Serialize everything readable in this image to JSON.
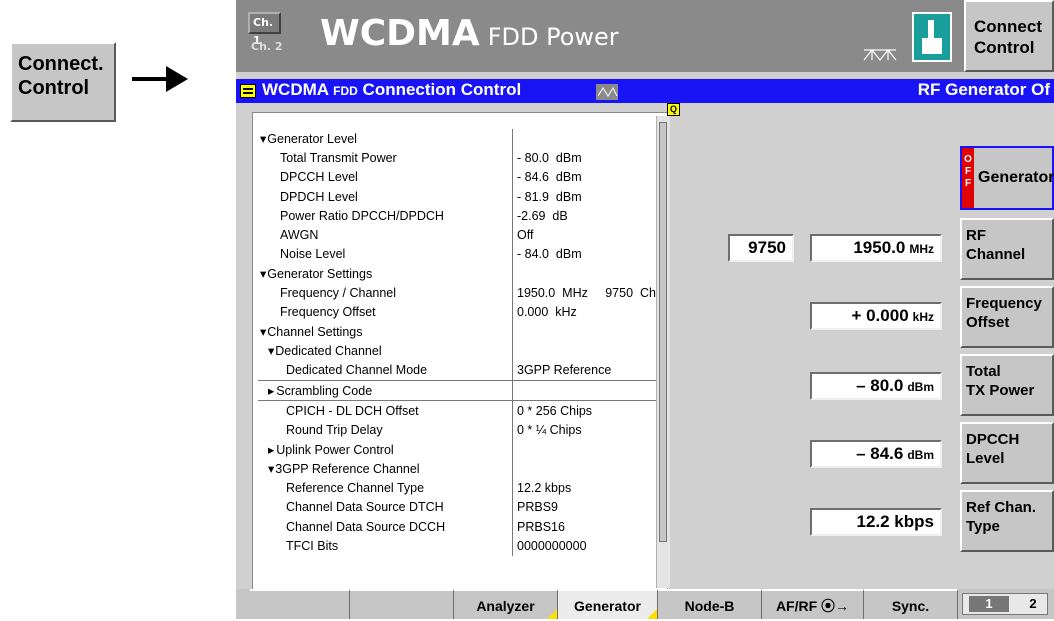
{
  "external_button": {
    "line1": "Connect.",
    "line2": "Control"
  },
  "titlebar": {
    "ch1": "Ch. 1",
    "ch2": "Ch. 2",
    "title_main": "WCDMA",
    "title_sub": "FDD  Power",
    "connect_line1": "Connect",
    "connect_line2": "Control"
  },
  "header": {
    "title": "WCDMA",
    "title_fdd": "FDD",
    "title_rest": "Connection Control",
    "status": "RF Generator Of"
  },
  "marker": "Q",
  "params": [
    {
      "label": "Generator Level",
      "value": "",
      "indent": 0,
      "expand": "down"
    },
    {
      "label": "Total Transmit Power",
      "value": "- 80.0  dBm",
      "indent": 1
    },
    {
      "label": "DPCCH Level",
      "value": "- 84.6  dBm",
      "indent": 1
    },
    {
      "label": "DPDCH Level",
      "value": "- 81.9  dBm",
      "indent": 1
    },
    {
      "label": "Power Ratio DPCCH/DPDCH",
      "value": "-2.69  dB",
      "indent": 1
    },
    {
      "label": "AWGN",
      "value": "Off",
      "indent": 1
    },
    {
      "label": "Noise Level",
      "value": "- 84.0  dBm",
      "indent": 1
    },
    {
      "label": "Generator Settings",
      "value": "",
      "indent": 0,
      "expand": "down"
    },
    {
      "label": "Frequency / Channel",
      "value": "1950.0  MHz     9750  Ch",
      "indent": 1
    },
    {
      "label": "Frequency Offset",
      "value": "0.000  kHz",
      "indent": 1
    },
    {
      "label": "Channel Settings",
      "value": "",
      "indent": 0,
      "expand": "down"
    },
    {
      "label": "Dedicated Channel",
      "value": "",
      "indent": 1,
      "expand": "down"
    },
    {
      "label": "Dedicated Channel Mode",
      "value": "3GPP Reference",
      "indent": 2
    },
    {
      "label": "Scrambling Code",
      "value": "",
      "indent": 1,
      "expand": "right",
      "selected": true
    },
    {
      "label": "CPICH - DL DCH Offset",
      "value": "0 * 256 Chips",
      "indent": 2
    },
    {
      "label": "Round Trip Delay",
      "value": "0 * ¼ Chips",
      "indent": 2
    },
    {
      "label": "Uplink Power Control",
      "value": "",
      "indent": 1,
      "expand": "right"
    },
    {
      "label": "3GPP Reference Channel",
      "value": "",
      "indent": 1,
      "expand": "down"
    },
    {
      "label": "Reference Channel Type",
      "value": "12.2 kbps",
      "indent": 2
    },
    {
      "label": "Channel Data Source DTCH",
      "value": "PRBS9",
      "indent": 2
    },
    {
      "label": "Channel Data Source DCCH",
      "value": "PRBS16",
      "indent": 2
    },
    {
      "label": "TFCI Bits",
      "value": "0000000000",
      "indent": 2
    }
  ],
  "value_boxes": {
    "channel": "9750",
    "rf_freq": "1950.0",
    "rf_unit": "MHz",
    "freq_offset": "+ 0.000",
    "freq_offset_unit": "kHz",
    "total_tx": "– 80.0",
    "total_tx_unit": "dBm",
    "dpcch": "– 84.6",
    "dpcch_unit": "dBm",
    "ref_chan": "12.2 kbps"
  },
  "softkeys": {
    "generator": {
      "badge": "OFF",
      "label": "Generator"
    },
    "rf_channel": {
      "line1": "RF",
      "line2": "Channel"
    },
    "freq_offset": {
      "line1": "Frequency",
      "line2": "Offset"
    },
    "total_tx": {
      "line1": "Total",
      "line2": "TX Power"
    },
    "dpcch": {
      "line1": "DPCCH",
      "line2": "Level"
    },
    "ref_chan": {
      "line1": "Ref Chan.",
      "line2": "Type"
    }
  },
  "tabs": [
    {
      "label": "",
      "active": false
    },
    {
      "label": "",
      "active": false
    },
    {
      "label": "Analyzer",
      "active": false
    },
    {
      "label": "Generator",
      "active": true
    },
    {
      "label": "Node-B",
      "active": false
    },
    {
      "label": "AF/RF",
      "active": false
    },
    {
      "label": "Sync.",
      "active": false
    }
  ],
  "pages": {
    "p1": "1",
    "p2": "2"
  },
  "colors": {
    "header_blue": "#1814f6",
    "title_gray": "#8a8a8a",
    "panel_gray": "#c6c6c6",
    "teal": "#1a9e9c",
    "off_red": "#e00000"
  }
}
